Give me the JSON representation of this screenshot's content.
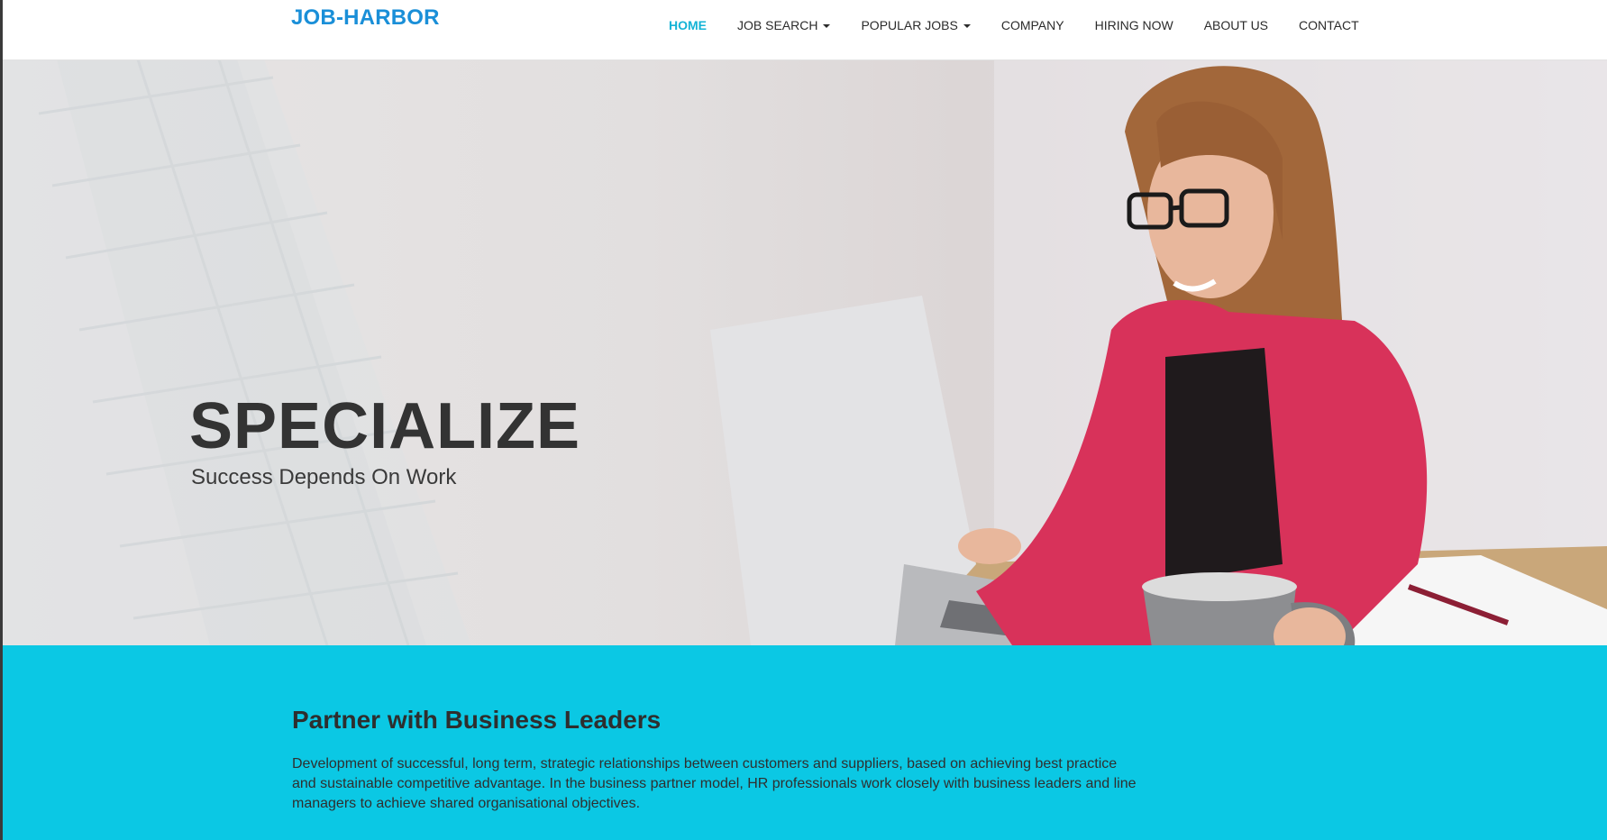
{
  "brand": {
    "name": "JOB-HARBOR"
  },
  "nav": {
    "items": [
      {
        "label": "HOME",
        "active": true,
        "dropdown": false
      },
      {
        "label": "JOB SEARCH",
        "active": false,
        "dropdown": true
      },
      {
        "label": "POPULAR JOBS",
        "active": false,
        "dropdown": true
      },
      {
        "label": "COMPANY",
        "active": false,
        "dropdown": false
      },
      {
        "label": "HIRING NOW",
        "active": false,
        "dropdown": false
      },
      {
        "label": "ABOUT US",
        "active": false,
        "dropdown": false
      },
      {
        "label": "CONTACT",
        "active": false,
        "dropdown": false
      }
    ]
  },
  "hero": {
    "title": "SPECIALIZE",
    "subtitle": "Success Depends On Work"
  },
  "partner": {
    "heading": "Partner with Business Leaders",
    "body": "Development of successful, long term, strategic relationships between customers and suppliers, based on achieving best practice and sustainable competitive advantage. In the business partner model, HR professionals work closely with business leaders and line managers to achieve shared organisational objectives."
  },
  "colors": {
    "brand": "#1a8fd8",
    "nav_active": "#14b3d6",
    "section_bg": "#0bc8e4",
    "jacket": "#d8325a"
  }
}
